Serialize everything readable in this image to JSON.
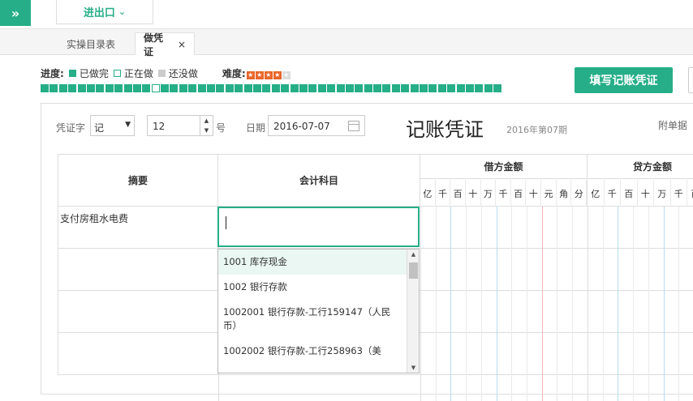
{
  "topbar": {
    "expand_icon": "»",
    "menu_label": "进出口",
    "menu_chevron": "⌄"
  },
  "tabs": [
    {
      "label": "实操目录表"
    },
    {
      "label": "做凭证",
      "close": "×"
    }
  ],
  "progress": {
    "label": "进度:",
    "done": "已做完",
    "doing": "正在做",
    "todo": "还没做",
    "difficulty_label": "难度:",
    "difficulty_stars": 4,
    "difficulty_max": 5,
    "block_count": 50,
    "current_block": 12
  },
  "actions": {
    "fill_voucher": "填写记账凭证"
  },
  "voucher": {
    "word_label": "凭证字",
    "word_value": "记",
    "number_value": "12",
    "number_suffix": "号",
    "date_label": "日期",
    "date_value": "2016-07-07",
    "title": "记账凭证",
    "period": "2016年第07期",
    "attachments_label": "附单据"
  },
  "table": {
    "headers": {
      "summary": "摘要",
      "account": "会计科目",
      "debit": "借方金额",
      "credit": "贷方金额"
    },
    "digits": [
      "亿",
      "千",
      "百",
      "十",
      "万",
      "千",
      "百",
      "十",
      "元",
      "角",
      "分"
    ],
    "credit_digits_visible": [
      "亿",
      "千",
      "百",
      "十",
      "万",
      "千",
      "百"
    ],
    "rows": [
      {
        "summary": "支付房租水电费"
      },
      {
        "summary": ""
      },
      {
        "summary": ""
      },
      {
        "summary": ""
      }
    ]
  },
  "account_dropdown": {
    "items": [
      "1001 库存现金",
      "1002 银行存款",
      "1002001 银行存款-工行159147（人民币）",
      "1002002 银行存款-工行258963（美"
    ]
  },
  "colors": {
    "accent": "#26ae88",
    "star": "#e8662b"
  }
}
